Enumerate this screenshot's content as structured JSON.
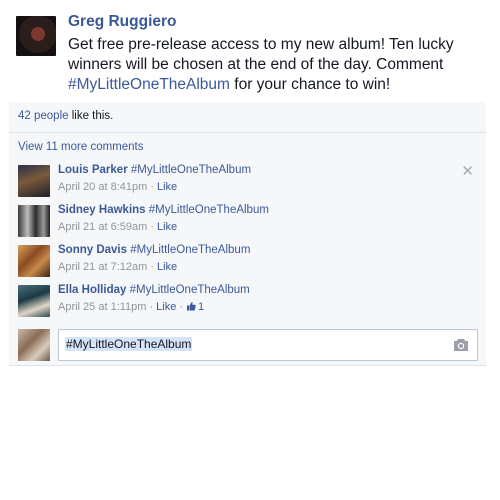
{
  "post": {
    "author": "Greg Ruggiero",
    "text_before": "Get free pre-release access to my new album! Ten lucky winners will be chosen at the end of the day. Comment ",
    "hashtag": "#MyLittleOneTheAlbum",
    "text_after": " for your chance to win!"
  },
  "likes": {
    "count_link": "42 people",
    "suffix": " like this."
  },
  "view_more": "View 11 more comments",
  "comments": [
    {
      "name": "Louis Parker",
      "text": "#MyLittleOneTheAlbum",
      "date": "April 20 at 8:41pm",
      "like": "Like",
      "likes": ""
    },
    {
      "name": "Sidney Hawkins",
      "text": "#MyLittleOneTheAlbum",
      "date": "April 21 at 6:59am",
      "like": "Like",
      "likes": ""
    },
    {
      "name": "Sonny Davis",
      "text": "#MyLittleOneTheAlbum",
      "date": "April 21 at 7:12am",
      "like": "Like",
      "likes": ""
    },
    {
      "name": "Ella Holliday",
      "text": "#MyLittleOneTheAlbum",
      "date": "April 25 at 1:11pm",
      "like": "Like",
      "likes": "1"
    }
  ],
  "compose": {
    "value": "#MyLittleOneTheAlbum"
  },
  "icons": {
    "close": "close-icon",
    "camera": "camera-icon",
    "thumbs_up": "thumbs-up-icon"
  },
  "colors": {
    "link": "#3b5998",
    "ufi_background": "#f6f7f8",
    "meta_text": "#90949c"
  }
}
